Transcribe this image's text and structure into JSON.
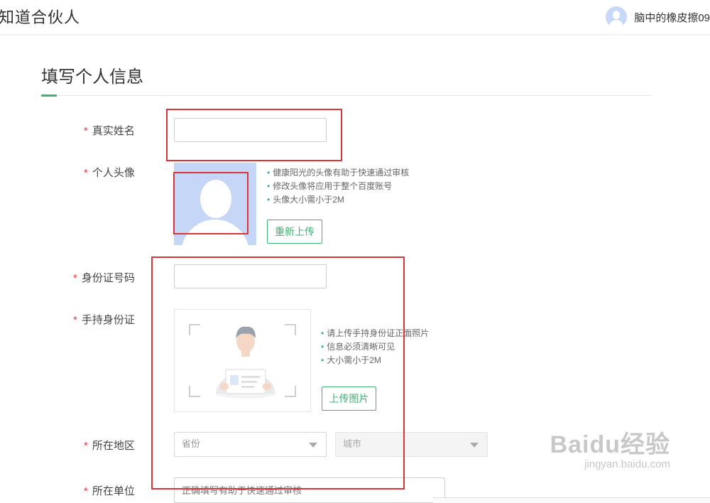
{
  "header": {
    "brand": "知道合伙人",
    "username": "脑中的橡皮擦09"
  },
  "form": {
    "title": "填写个人信息",
    "required_mark": "*",
    "fields": {
      "real_name": {
        "label": "真实姓名",
        "value": "",
        "placeholder": ""
      },
      "avatar": {
        "label": "个人头像",
        "tips": [
          "健康阳光的头像有助于快速通过审核",
          "修改头像将应用于整个百度账号",
          "头像大小需小于2M"
        ],
        "button": "重新上传"
      },
      "id_number": {
        "label": "身份证号码",
        "value": "",
        "placeholder": ""
      },
      "id_photo": {
        "label": "手持身份证",
        "tips": [
          "请上传手持身份证正面照片",
          "信息必须清晰可见",
          "大小需小于2M"
        ],
        "button": "上传图片"
      },
      "region": {
        "label": "所在地区",
        "province": "省份",
        "city": "城市"
      },
      "company": {
        "label": "所在单位",
        "placeholder": "正确填写有助于快速通过审核"
      }
    }
  },
  "watermark": {
    "main": "Baidu经验",
    "sub": "jingyan.baidu.com"
  },
  "colors": {
    "accent": "#3cb371",
    "required": "#e4393c",
    "highlight": "#d9343a"
  }
}
